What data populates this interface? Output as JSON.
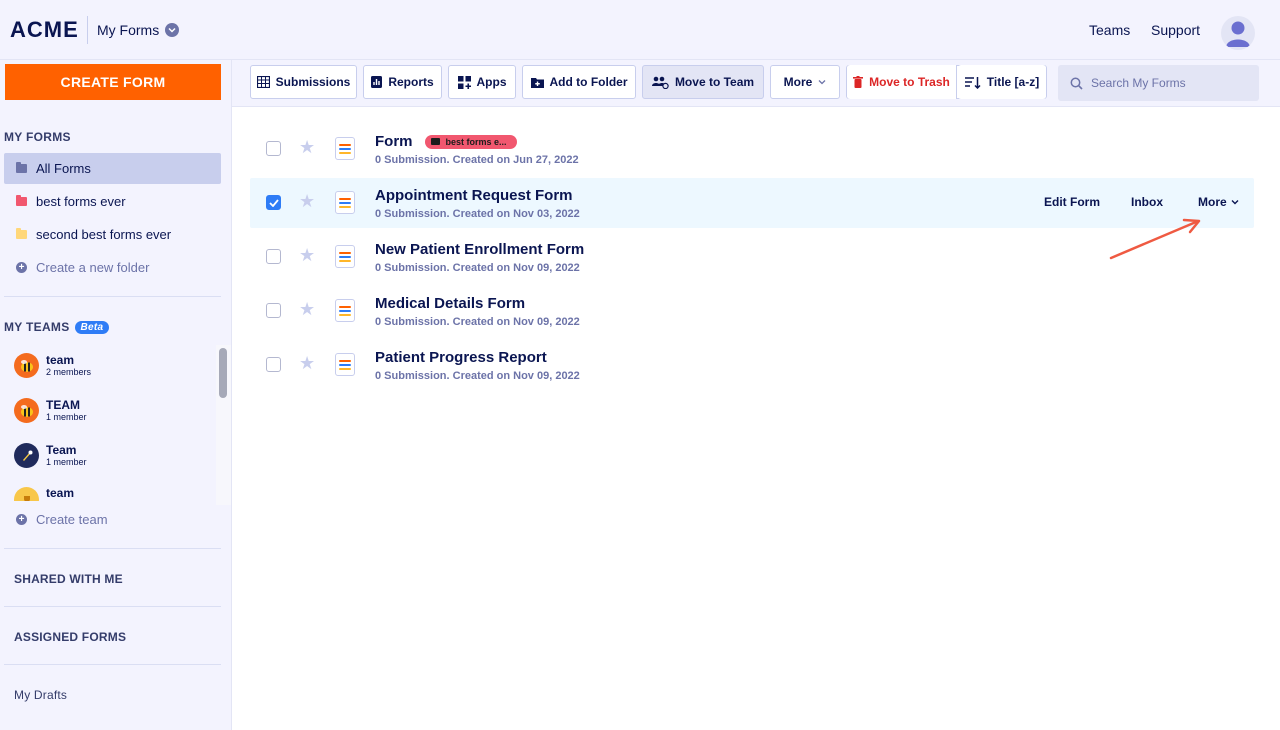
{
  "header": {
    "logo": "ACME",
    "title": "My Forms",
    "nav": [
      "Teams",
      "Support"
    ]
  },
  "sidebar": {
    "create_label": "CREATE FORM",
    "my_forms_heading": "MY FORMS",
    "folders": [
      {
        "label": "All Forms",
        "color": "#6c73a8",
        "active": true
      },
      {
        "label": "best forms ever",
        "color": "#f1576f",
        "active": false
      },
      {
        "label": "second best forms ever",
        "color": "#ffd77a",
        "active": false
      }
    ],
    "create_folder_label": "Create a new folder",
    "my_teams_heading": "MY TEAMS",
    "beta_label": "Beta",
    "teams": [
      {
        "name": "team",
        "members": "2 members",
        "icon": "bee-icon"
      },
      {
        "name": "TEAM",
        "members": "1 member",
        "icon": "bee-icon"
      },
      {
        "name": "Team",
        "members": "1 member",
        "icon": "rocket-icon"
      },
      {
        "name": "team",
        "members": "",
        "icon": "trophy-icon"
      }
    ],
    "create_team_label": "Create team",
    "shared_label": "SHARED WITH ME",
    "assigned_label": "ASSIGNED FORMS",
    "drafts_label": "My Drafts"
  },
  "toolbar": {
    "submissions": "Submissions",
    "reports": "Reports",
    "apps": "Apps",
    "add_to_folder": "Add to Folder",
    "move_to_team": "Move to Team",
    "more": "More",
    "move_to_trash": "Move to Trash",
    "sort": "Title [a-z]",
    "search_placeholder": "Search My Forms"
  },
  "forms": [
    {
      "title": "Form",
      "meta": "0 Submission. Created on Jun 27, 2022",
      "tag": "best forms e...",
      "checked": false
    },
    {
      "title": "Appointment Request Form",
      "meta": "0 Submission. Created on Nov 03, 2022",
      "checked": true
    },
    {
      "title": "New Patient Enrollment Form",
      "meta": "0 Submission. Created on Nov 09, 2022",
      "checked": false
    },
    {
      "title": "Medical Details Form",
      "meta": "0 Submission. Created on Nov 09, 2022",
      "checked": false
    },
    {
      "title": "Patient Progress Report",
      "meta": "0 Submission. Created on Nov 09, 2022",
      "checked": false
    }
  ],
  "row_actions": {
    "edit": "Edit Form",
    "inbox": "Inbox",
    "more": "More"
  },
  "colors": {
    "accent": "#ff6100",
    "primary_text": "#0a1551",
    "checkbox": "#2e7cf6",
    "danger": "#dc2626",
    "annotation_arrow": "#ef5a42"
  }
}
